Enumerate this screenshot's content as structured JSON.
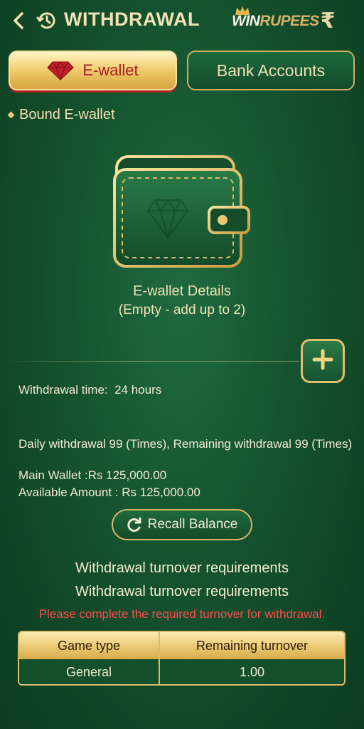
{
  "header": {
    "title": "WITHDRAWAL",
    "back_icon": "chevron-left-icon",
    "history_icon": "history-clock-icon",
    "brand": {
      "win": "WIN",
      "rupees": "RUPEES",
      "symbol": "₹"
    }
  },
  "tabs": [
    {
      "label": "E-wallet",
      "icon": "diamond-gem-icon",
      "active": true
    },
    {
      "label": "Bank Accounts",
      "active": false
    }
  ],
  "section_title": "Bound E-wallet",
  "wallet": {
    "details_title": "E-wallet Details",
    "details_sub": "(Empty - add up to 2)",
    "add_icon": "plus-icon"
  },
  "info": {
    "withdrawal_time": "Withdrawal time:  24 hours",
    "daily": "Daily withdrawal 99 (Times), Remaining withdrawal 99 (Times)",
    "main_wallet": "Main Wallet :Rs 125,000.00",
    "available": "Available Amount : Rs 125,000.00"
  },
  "recall_button": "Recall Balance",
  "requirements": {
    "line1": "Withdrawal turnover requirements",
    "line2": "Withdrawal turnover requirements",
    "warning": "Please complete the required turnover for withdrawal."
  },
  "table": {
    "headers": [
      "Game type",
      "Remaining turnover"
    ],
    "rows": [
      [
        "General",
        "1.00"
      ]
    ]
  },
  "colors": {
    "background": "#15532f",
    "gold": "#d9bb6c",
    "warning": "#ff4c4c",
    "active_tab_text": "#a81d22"
  }
}
